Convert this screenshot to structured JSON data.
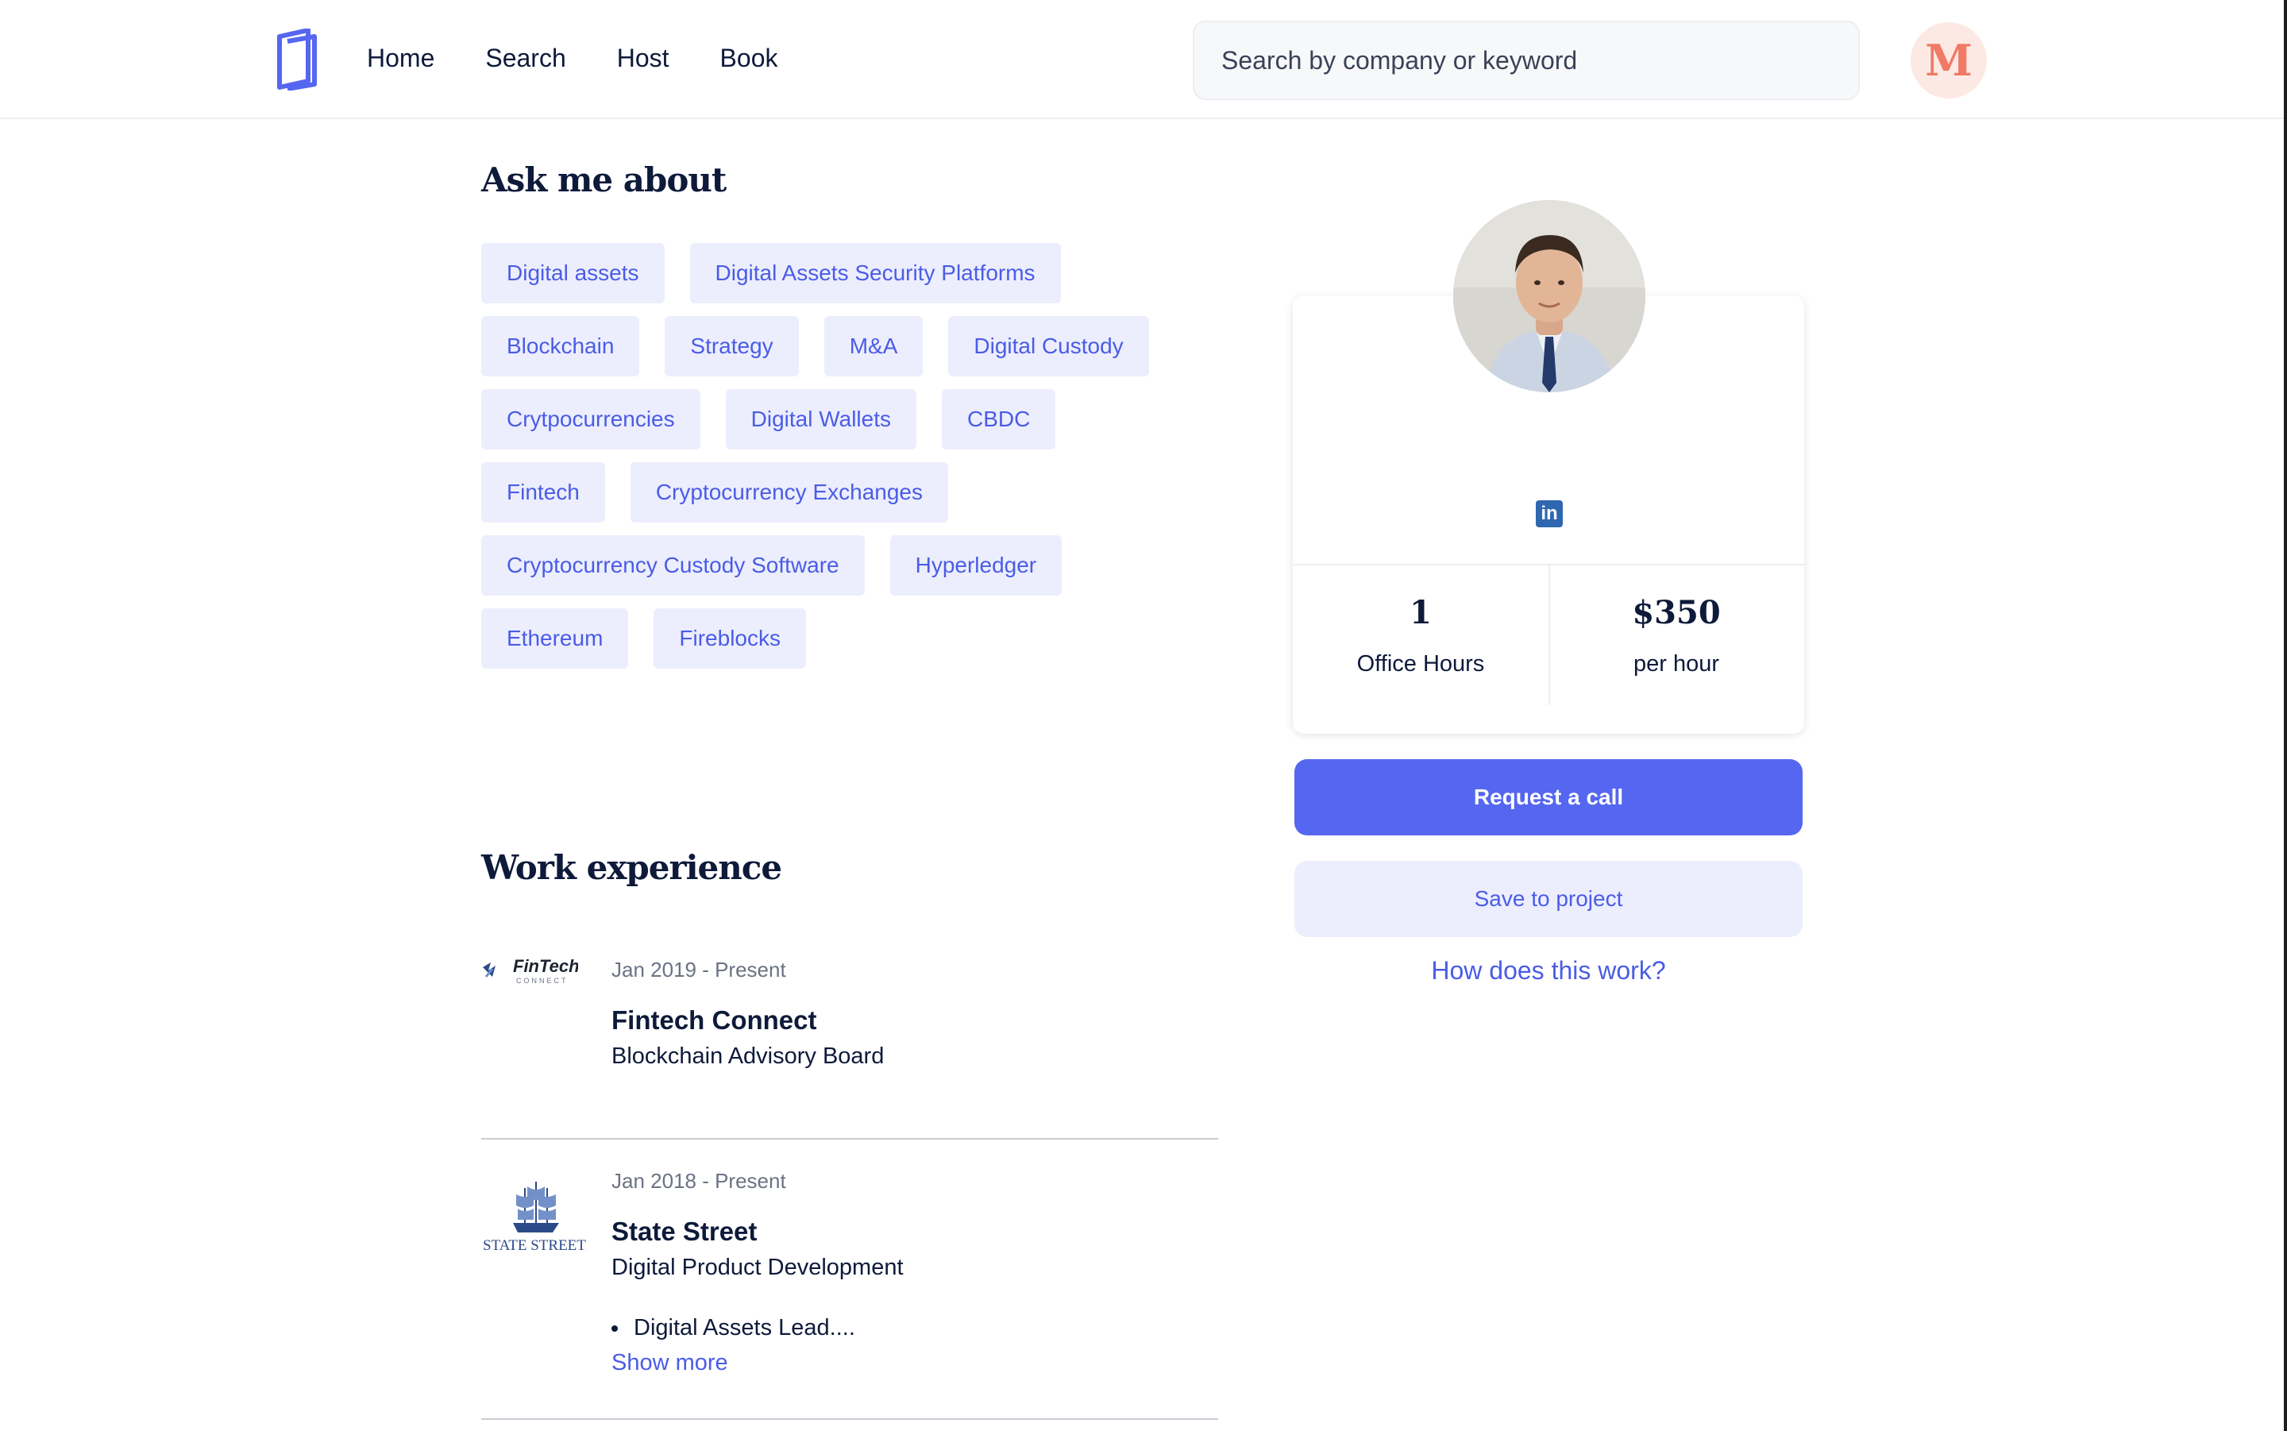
{
  "nav": {
    "items": [
      "Home",
      "Search",
      "Host",
      "Book"
    ]
  },
  "search": {
    "placeholder": "Search by company or keyword"
  },
  "user": {
    "avatar_letter": "M"
  },
  "ask": {
    "title": "Ask me about",
    "rows": [
      [
        "Digital assets",
        "Digital Assets Security Platforms"
      ],
      [
        "Blockchain",
        "Strategy",
        "M&A",
        "Digital Custody"
      ],
      [
        "Crytpocurrencies",
        "Digital Wallets",
        "CBDC"
      ],
      [
        "Fintech",
        "Cryptocurrency Exchanges"
      ],
      [
        "Cryptocurrency Custody Software",
        "Hyperledger"
      ],
      [
        "Ethereum",
        "Fireblocks"
      ]
    ]
  },
  "work": {
    "title": "Work experience",
    "jobs": [
      {
        "dates": "Jan 2019 - Present",
        "company": "Fintech Connect",
        "role": "Blockchain Advisory Board",
        "logo_text": "FinTech",
        "logo_sub": "CONNECT"
      },
      {
        "dates": "Jan 2018 - Present",
        "company": "State Street",
        "role": "Digital Product Development",
        "bullet": "Digital Assets Lead....",
        "more": "Show more",
        "logo_text": "STATE STREET."
      }
    ]
  },
  "profile": {
    "social_icon": "linkedin-icon",
    "stats": [
      {
        "value": "1",
        "label": "Office Hours"
      },
      {
        "value": "$350",
        "label": "per hour"
      }
    ]
  },
  "actions": {
    "request": "Request a call",
    "save": "Save to project",
    "how": "How does this work?"
  },
  "colors": {
    "accent": "#5566f0",
    "tag_bg": "#eceefd",
    "tag_text": "#4b5ce6",
    "heading": "#0e1a3a"
  }
}
